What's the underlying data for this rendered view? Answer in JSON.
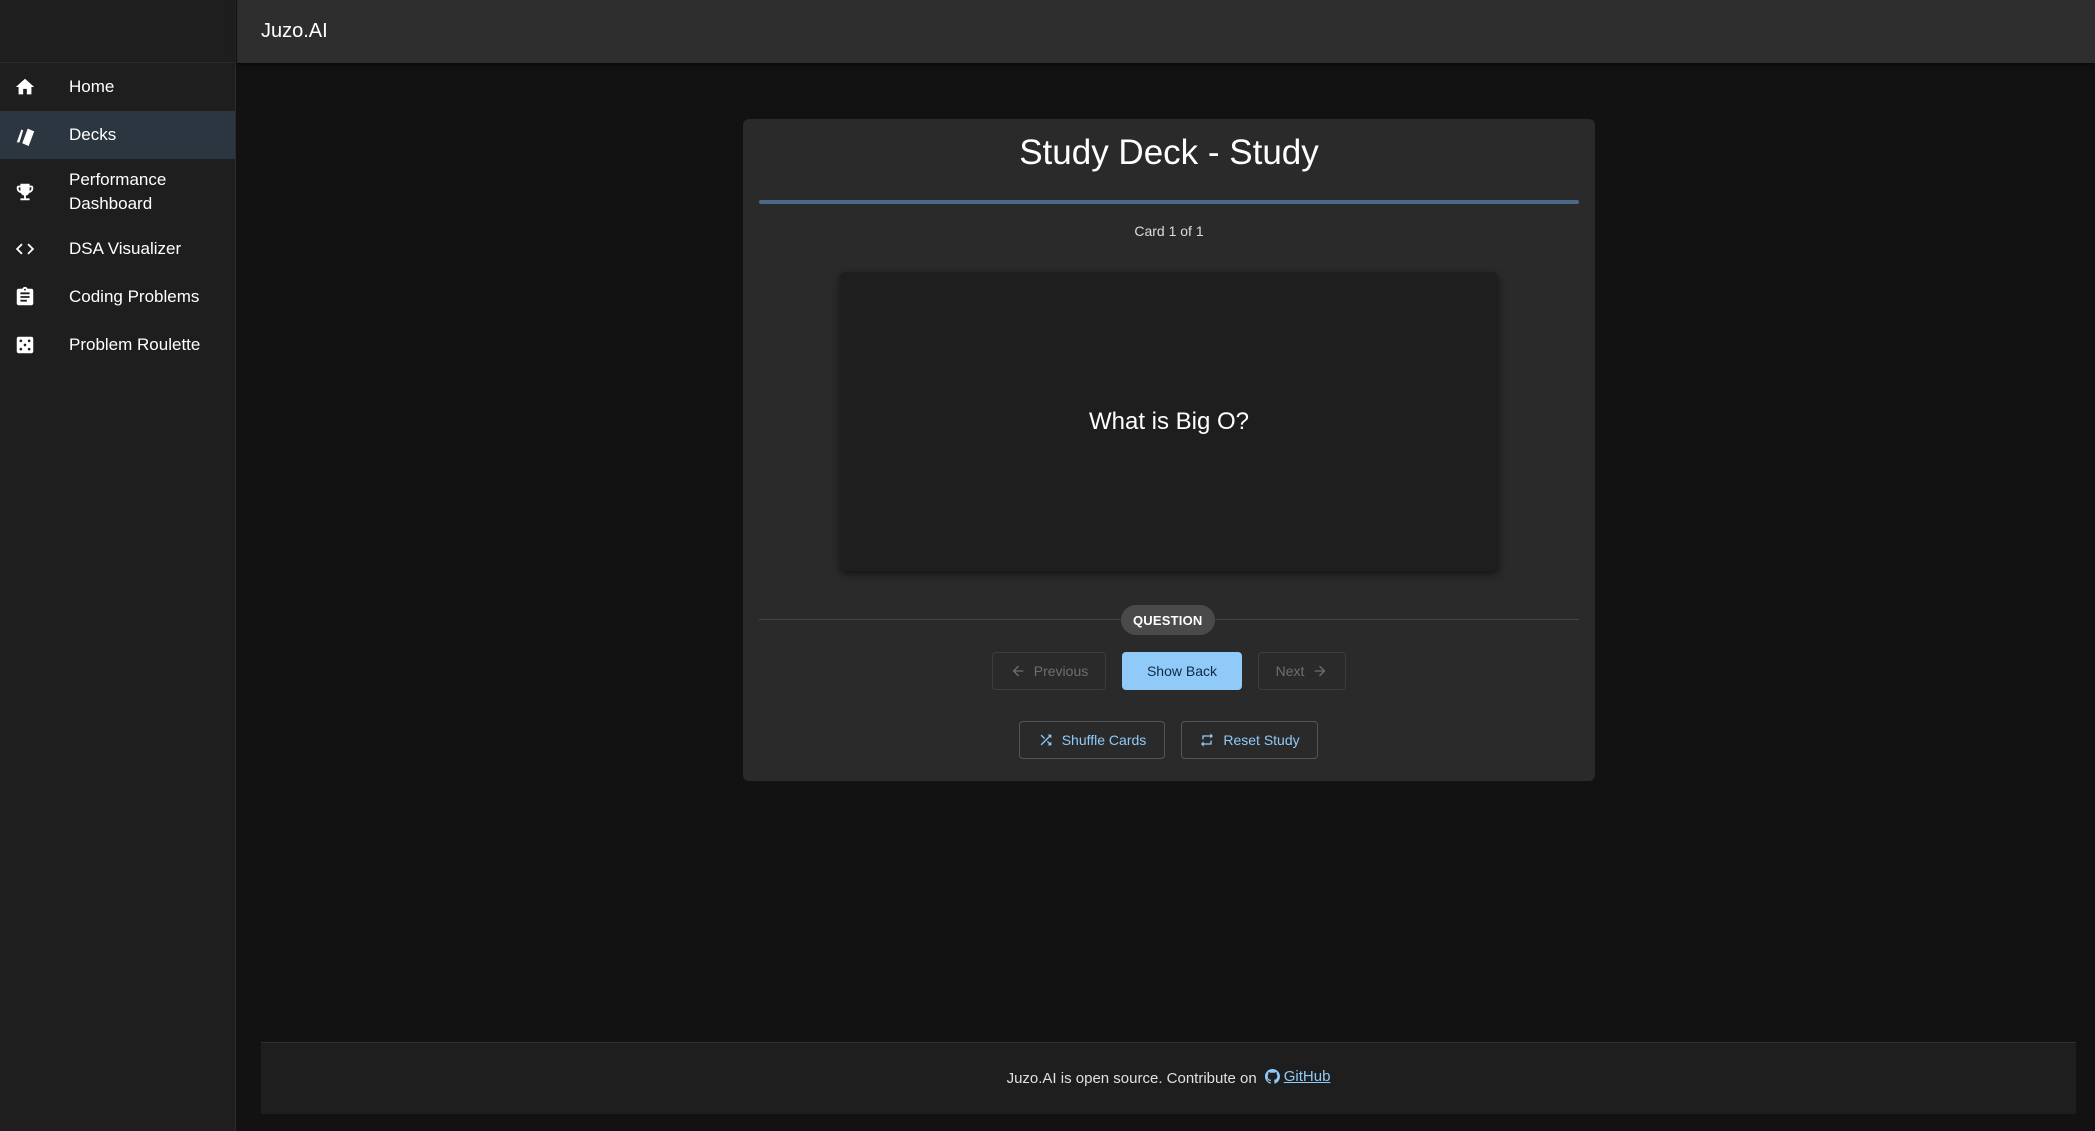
{
  "app": {
    "title": "Juzo.AI"
  },
  "sidebar": {
    "items": [
      {
        "label": "Home",
        "icon": "home-icon",
        "active": false
      },
      {
        "label": "Decks",
        "icon": "cards-icon",
        "active": true
      },
      {
        "label": "Performance Dashboard",
        "icon": "trophy-icon",
        "active": false
      },
      {
        "label": "DSA Visualizer",
        "icon": "code-icon",
        "active": false
      },
      {
        "label": "Coding Problems",
        "icon": "clipboard-icon",
        "active": false
      },
      {
        "label": "Problem Roulette",
        "icon": "dice-icon",
        "active": false
      }
    ]
  },
  "study": {
    "title": "Study Deck - Study",
    "progress": 1.0,
    "counter": "Card 1 of 1",
    "card_text": "What is Big O?",
    "side_label": "QUESTION",
    "buttons": {
      "previous": "Previous",
      "show_back": "Show Back",
      "next": "Next",
      "shuffle": "Shuffle Cards",
      "reset": "Reset Study"
    }
  },
  "footer": {
    "text": "Juzo.AI is open source. Contribute on",
    "link_label": "GitHub"
  },
  "colors": {
    "accent": "#90caf9",
    "background": "#121212",
    "surface": "#2a2a2a",
    "sidebar_active": "#2b3640"
  }
}
